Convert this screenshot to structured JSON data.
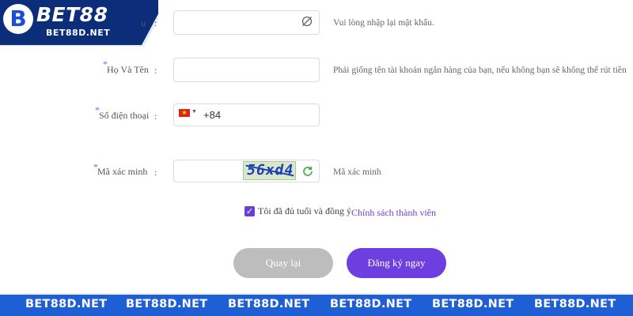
{
  "brand": {
    "name": "BET88",
    "subname": "BET88D.NET",
    "letter": "B"
  },
  "form": {
    "password_confirm": {
      "label_partial": "u",
      "colon": ":",
      "hint": "Vui lòng nhập lại mật khẩu."
    },
    "full_name": {
      "star": "*",
      "label": "Họ Và Tên",
      "colon": ":",
      "hint": "Phải giống tên tài khoản ngân hàng của bạn, nếu không bạn sẽ không thể rút tiền"
    },
    "phone": {
      "star": "*",
      "label": "Số điện thoại",
      "colon": ":",
      "country_flag": "vietnam-flag-icon",
      "value": "+84"
    },
    "captcha": {
      "star": "*",
      "label": "Mã xác minh",
      "colon": ":",
      "image_text": "56xd4",
      "hint": "Mã xác minh"
    },
    "agreement": {
      "checked": true,
      "check_mark": "✓",
      "text": "Tôi đã đủ tuổi và đồng ý",
      "link": "Chính sách thành viên"
    }
  },
  "buttons": {
    "back": "Quay lại",
    "register": "Đăng ký ngay"
  },
  "footer": {
    "items": [
      "BET88D.NET",
      "BET88D.NET",
      "BET88D.NET",
      "BET88D.NET",
      "BET88D.NET",
      "BET88D.NET"
    ]
  },
  "colors": {
    "accent": "#6d3fe0",
    "footer_bg": "#1f5fd6",
    "logo_bg": "#0b2d7a",
    "button_disabled": "#bdbdbd"
  }
}
